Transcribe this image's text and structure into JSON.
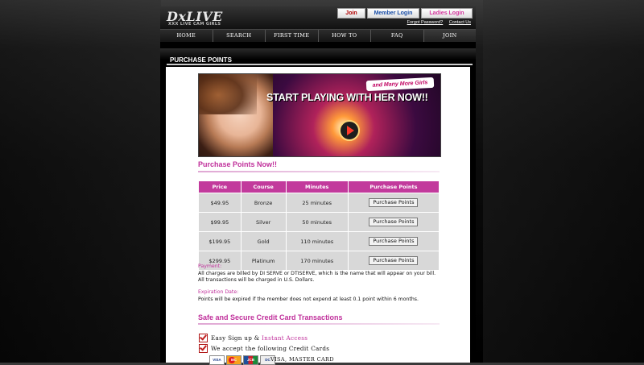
{
  "header": {
    "logo": "DxLIVE",
    "tagline": "XXX LIVE CAM GIRLS",
    "join_button": "Join",
    "member_login_button": "Member Login",
    "ladies_login_button": "Ladies Login",
    "forgot_password": "Forgot Password?",
    "contact_us": "Contact Us"
  },
  "nav": {
    "items": [
      "HOME",
      "SEARCH",
      "FIRST TIME",
      "HOW TO",
      "FAQ",
      "JOIN"
    ]
  },
  "page": {
    "title": "PURCHASE POINTS"
  },
  "banner": {
    "tag": "and Many More Girls",
    "headline": "START PLAYING WITH HER NOW!!"
  },
  "purchase": {
    "heading": "Purchase Points Now!!",
    "columns": [
      "Price",
      "Course",
      "Minutes",
      "Purchase Points"
    ],
    "rows": [
      {
        "price": "$49.95",
        "course": "Bronze",
        "minutes": "25 minutes",
        "button": "Purchase Points"
      },
      {
        "price": "$99.95",
        "course": "Silver",
        "minutes": "50 minutes",
        "button": "Purchase Points"
      },
      {
        "price": "$199.95",
        "course": "Gold",
        "minutes": "110 minutes",
        "button": "Purchase Points"
      },
      {
        "price": "$299.95",
        "course": "Platinum",
        "minutes": "170 minutes",
        "button": "Purchase Points"
      }
    ]
  },
  "payment": {
    "label": "Payment:",
    "line1": "All charges are billed by DI SERVE or DTISERVE, which is the name that will appear on your bill.",
    "line2": "All transactions will be charged in U.S. Dollars."
  },
  "expiration": {
    "label": "Expiration Date:",
    "text": "Points will be expired if the member does not expend at least 0.1 point within 6 months."
  },
  "secure": {
    "heading": "Safe and Secure Credit Card Transactions",
    "feature1_a": "Easy Sign up & ",
    "feature1_b": "Instant Access",
    "feature2": "We accept the following Credit Cards",
    "cards": [
      "VISA",
      "MC",
      "JCB",
      "DC"
    ],
    "cards_text": "VISA, MASTER CARD"
  },
  "colors": {
    "accent": "#c0309b",
    "table_header": "#c23a9c",
    "table_cell": "#d8d8d8"
  }
}
